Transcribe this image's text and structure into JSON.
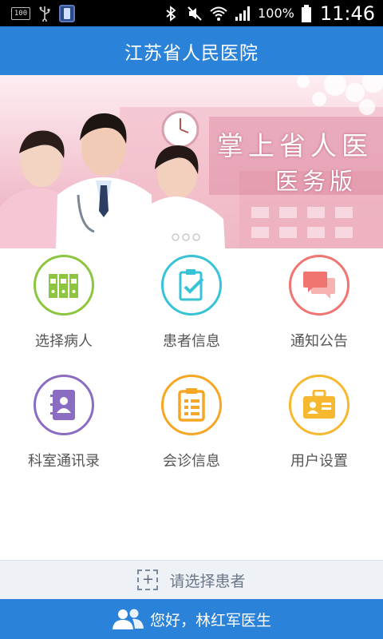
{
  "status_bar": {
    "notification_box": "100",
    "battery_percent": "100%",
    "time": "11:46",
    "icons": [
      "usb-icon",
      "app-notification-icon",
      "bluetooth-icon",
      "mute-icon",
      "wifi-icon",
      "signal-icon",
      "battery-icon"
    ]
  },
  "header": {
    "title": "江苏省人民医院"
  },
  "banner": {
    "line1": "掌上省人医",
    "line2": "医务版"
  },
  "menu": {
    "items": [
      {
        "label": "选择病人",
        "icon": "binders-icon",
        "color": "#8cc63f"
      },
      {
        "label": "患者信息",
        "icon": "clipboard-check-icon",
        "color": "#37c3d6"
      },
      {
        "label": "通知公告",
        "icon": "chat-bubbles-icon",
        "color": "#f07470"
      },
      {
        "label": "科室通讯录",
        "icon": "address-book-icon",
        "color": "#8b6cc3"
      },
      {
        "label": "会诊信息",
        "icon": "checklist-icon",
        "color": "#f5a623"
      },
      {
        "label": "用户设置",
        "icon": "id-card-icon",
        "color": "#f5b82e"
      }
    ]
  },
  "patient_select": {
    "label": "请选择患者"
  },
  "footer": {
    "greeting": "您好，林红军医生"
  },
  "colors": {
    "primary": "#2b82d9",
    "select_bar_bg": "#eef1f5"
  }
}
